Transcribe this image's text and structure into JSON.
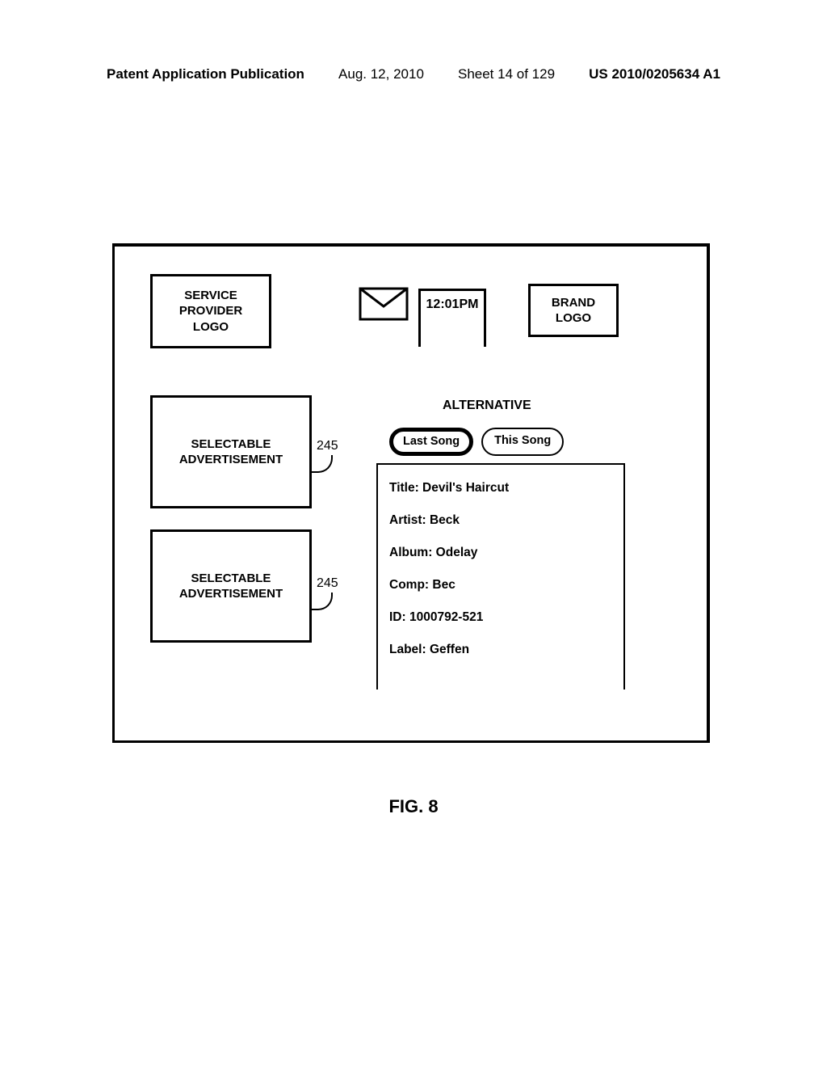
{
  "header": {
    "left": "Patent Application Publication",
    "date": "Aug. 12, 2010",
    "sheet": "Sheet 14 of 129",
    "pubno": "US 2010/0205634 A1"
  },
  "svcProvider": {
    "line1": "SERVICE",
    "line2": "PROVIDER",
    "line3": "LOGO"
  },
  "clock": "12:01PM",
  "brandLogo": {
    "line1": "BRAND",
    "line2": "LOGO"
  },
  "ad1": {
    "line1": "SELECTABLE",
    "line2": "ADVERTISEMENT"
  },
  "ad2": {
    "line1": "SELECTABLE",
    "line2": "ADVERTISEMENT"
  },
  "callout1": "245",
  "callout2": "245",
  "genre": "ALTERNATIVE",
  "buttons": {
    "last": "Last Song",
    "this": "This Song"
  },
  "info": {
    "title": "Title:  Devil's Haircut",
    "artist": "Artist:  Beck",
    "album": "Album:  Odelay",
    "comp": "Comp:  Bec",
    "id": "ID:  1000792-521",
    "label": "Label:  Geffen"
  },
  "figLabel": "FIG. 8"
}
